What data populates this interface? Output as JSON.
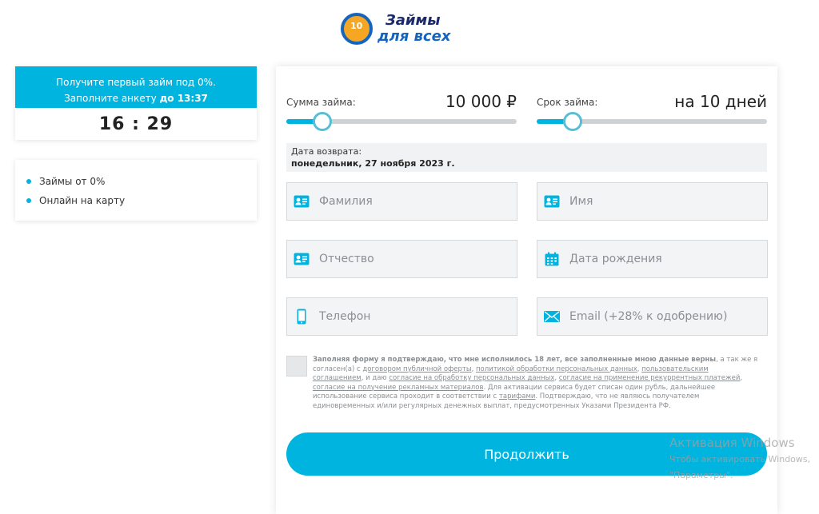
{
  "logo": {
    "coin_label": "10",
    "line1": "Займы",
    "line2": "для всех"
  },
  "promo": {
    "line1": "Получите первый займ под 0%.",
    "line2_prefix": "Заполните анкету",
    "line2_bold": "до 13:37",
    "timer": "16 : 29"
  },
  "features": [
    "Займы от 0%",
    "Онлайн на карту"
  ],
  "amount": {
    "label": "Сумма займа:",
    "value": "10 000 ₽",
    "level": 0.08
  },
  "term": {
    "label": "Срок займа:",
    "value": "на 10 дней",
    "level": 0.08
  },
  "return": {
    "label": "Дата возврата:",
    "date": "понедельник, 27 ноября 2023 г."
  },
  "fields": {
    "surname": "Фамилия",
    "name": "Имя",
    "patronymic": "Отчество",
    "birthdate": "Дата рождения",
    "phone": "Телефон",
    "email": "Email (+28% к одобрению)"
  },
  "agreement": {
    "bold": "Заполняя форму я подтверждаю, что мне исполнилось 18 лет, все заполненные мною данные верны",
    "t1": ", а так же я согласен(а) с ",
    "link1": "договором публичной оферты",
    "t2": ", ",
    "link2": "политикой обработки персональных данных",
    "t3": ", ",
    "link3": "пользовательским соглашением",
    "t4": ", и даю ",
    "link4": "согласие на обработку персональных данных",
    "t5": ", ",
    "link5": "согласие на применение рекуррентных платежей",
    "t6": ", ",
    "link6": "согласие на получение рекламных материалов",
    "t7": ". Для активации сервиса будет списан один рубль, дальнейшее использование сервиса проходит в соответствии с ",
    "link7": "тарифами",
    "t8": ". Подтверждаю, что не являюсь получателем единовременных и/или регулярных денежных выплат, предусмотренных Указами Президента РФ."
  },
  "submit_label": "Продолжить",
  "watermark": {
    "line1": "Активация Windows",
    "line2": "Чтобы активировать Windows,",
    "line3": "\"Параметры\"."
  },
  "colors": {
    "accent": "#00b4e0",
    "field_bg": "#f3f4f5"
  }
}
